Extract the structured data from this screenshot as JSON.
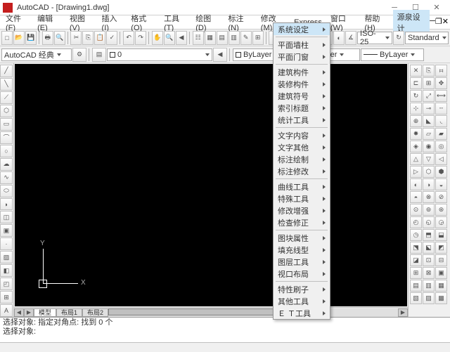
{
  "title": "AutoCAD - [Drawing1.dwg]",
  "menus": [
    "文件(F)",
    "编辑(E)",
    "视图(V)",
    "插入(I)",
    "格式(O)",
    "工具(T)",
    "绘图(D)",
    "标注(N)",
    "修改(M)",
    "Express",
    "窗口(W)",
    "帮助(H)",
    "源泉设计"
  ],
  "workspace_sel": "AutoCAD 经典",
  "style_sel1": "ISO-25",
  "style_sel2": "Standard",
  "layer_props": [
    "ByLayer",
    "ByLayer",
    "ByLayer"
  ],
  "dropdown": {
    "groups": [
      [
        "系统设定"
      ],
      [
        "平面墙柱",
        "平面门窗"
      ],
      [
        "建筑构件",
        "装修构件",
        "建筑符号",
        "索引标题",
        "统计工具"
      ],
      [
        "文字内容",
        "文字其他",
        "标注绘制",
        "标注修改"
      ],
      [
        "曲线工具",
        "特殊工具",
        "修改增强",
        "检查修正"
      ],
      [
        "图块属性",
        "填充线型",
        "图层工具",
        "视口布局"
      ],
      [
        "特性刷子",
        "其他工具",
        "Ｅ Ｔ工具"
      ]
    ],
    "highlight": "系统设定"
  },
  "tabs": [
    "模型",
    "布局1",
    "布局2"
  ],
  "cmd": {
    "line1": "选择对象: 指定对角点: 找到 0 个",
    "line2": "选择对象:"
  },
  "ucs": {
    "x": "X",
    "y": "Y"
  },
  "chart_data": {
    "type": "table",
    "note": "black CAD canvas, no drawing content"
  }
}
